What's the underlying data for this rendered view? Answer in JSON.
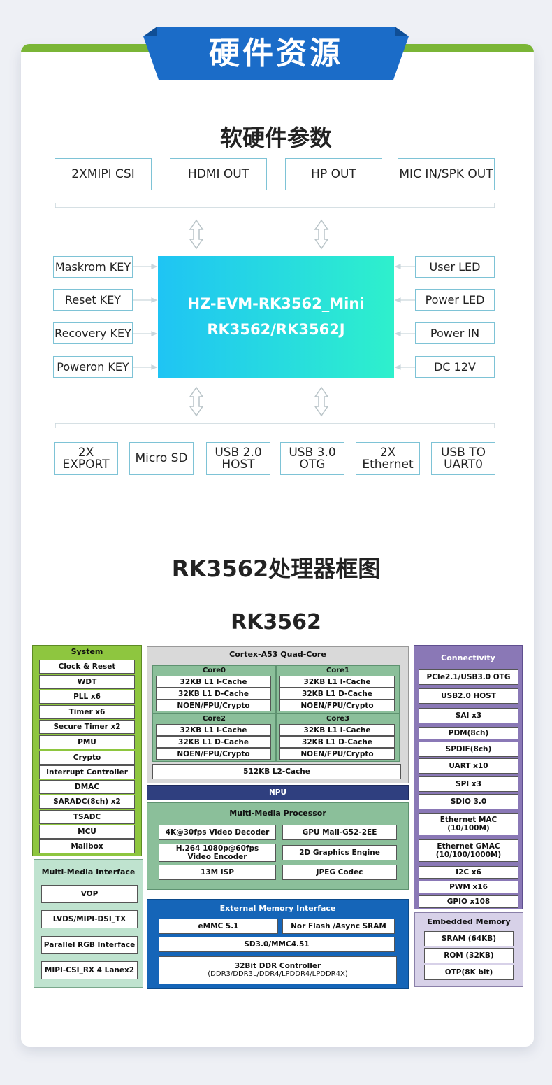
{
  "banner": {
    "title": "硬件资源"
  },
  "section1": {
    "title": "软硬件参数",
    "top_ports": [
      "2XMIPI CSI",
      "HDMI OUT",
      "HP OUT",
      "MIC IN/SPK OUT"
    ],
    "left_keys": [
      "Maskrom KEY",
      "Reset KEY",
      "Recovery KEY",
      "Poweron KEY"
    ],
    "right_items": [
      "User LED",
      "Power LED",
      "Power IN",
      "DC 12V"
    ],
    "chip_line1": "HZ-EVM-RK3562_Mini",
    "chip_line2": "RK3562/RK3562J",
    "bottom_ports": [
      [
        "2X",
        "EXPORT"
      ],
      [
        "Micro SD"
      ],
      [
        "USB 2.0",
        "HOST"
      ],
      [
        "USB 3.0",
        "OTG"
      ],
      [
        "2X",
        "Ethernet"
      ],
      [
        "USB TO",
        "UART0"
      ]
    ]
  },
  "section2": {
    "title": "RK3562处理器框图",
    "diagram_title": "RK3562",
    "system": {
      "title": "System",
      "items": [
        "Clock & Reset",
        "WDT",
        "PLL x6",
        "Timer x6",
        "Secure Timer x2",
        "PMU",
        "Crypto",
        "Interrupt Controller",
        "DMAC",
        "SARADC(8ch) x2",
        "TSADC",
        "MCU",
        "Mailbox"
      ]
    },
    "mm_interface": {
      "title": "Multi-Media Interface",
      "items": [
        "VOP",
        "LVDS/MIPI-DSI_TX",
        "Parallel RGB Interface",
        "MIPI-CSI_RX 4 Lanex2"
      ]
    },
    "cpu": {
      "title": "Cortex-A53 Quad-Core",
      "cores": [
        {
          "name": "Core0",
          "items": [
            "32KB L1 I-Cache",
            "32KB L1 D-Cache",
            "NOEN/FPU/Crypto"
          ]
        },
        {
          "name": "Core1",
          "items": [
            "32KB L1 I-Cache",
            "32KB L1 D-Cache",
            "NOEN/FPU/Crypto"
          ]
        },
        {
          "name": "Core2",
          "items": [
            "32KB L1 I-Cache",
            "32KB L1 D-Cache",
            "NOEN/FPU/Crypto"
          ]
        },
        {
          "name": "Core3",
          "items": [
            "32KB L1 I-Cache",
            "32KB L1 D-Cache",
            "NOEN/FPU/Crypto"
          ]
        }
      ],
      "l2": "512KB L2-Cache"
    },
    "npu": "NPU",
    "mmp": {
      "title": "Multi-Media Processor",
      "items": [
        [
          "4K@30fps Video  Decoder",
          ""
        ],
        [
          "GPU Mali-G52-2EE",
          ""
        ],
        [
          "H.264 1080p@60fps",
          "Video  Encoder"
        ],
        [
          "2D Graphics Engine",
          ""
        ],
        [
          "13M ISP",
          ""
        ],
        [
          "JPEG Codec",
          ""
        ]
      ]
    },
    "ext_mem": {
      "title": "External Memory Interface",
      "emmc": "eMMC 5.1",
      "nor": "Nor Flash /Async SRAM",
      "sd": "SD3.0/MMC4.51",
      "ddr1": "32Bit DDR Controller",
      "ddr2": "(DDR3/DDR3L/DDR4/LPDDR4/LPDDR4X)"
    },
    "connectivity": {
      "title": "Connectivity",
      "items": [
        [
          "PCIe2.1/USB3.0 OTG"
        ],
        [
          "USB2.0 HOST"
        ],
        [
          "SAI x3"
        ],
        [
          "PDM(8ch)"
        ],
        [
          "SPDIF(8ch)"
        ],
        [
          "UART x10"
        ],
        [
          "SPI x3"
        ],
        [
          "SDIO 3.0"
        ],
        [
          "Ethernet MAC",
          "(10/100M)"
        ],
        [
          "Ethernet GMAC",
          "(10/100/1000M)"
        ],
        [
          "I2C x6"
        ],
        [
          "PWM x16"
        ],
        [
          "GPIO x108"
        ]
      ]
    },
    "emb_mem": {
      "title": "Embedded Memory",
      "items": [
        "SRAM (64KB)",
        "ROM (32KB)",
        "OTP(8K bit)"
      ]
    }
  },
  "colors": {
    "accent_blue": "#1b6cc8",
    "accent_green": "#7ab536",
    "box_border": "#7ec3d6",
    "chip_start": "#1fc4f4",
    "chip_end": "#2ef0cc",
    "sys_green": "#8ec63f",
    "cpu_grey": "#d9d9d9",
    "core_green": "#8bbf9a",
    "npu_navy": "#2f3f7f",
    "ext_blue": "#1565b8",
    "conn_purple": "#8a78b6",
    "emb_lavender": "#d7d1e8"
  }
}
